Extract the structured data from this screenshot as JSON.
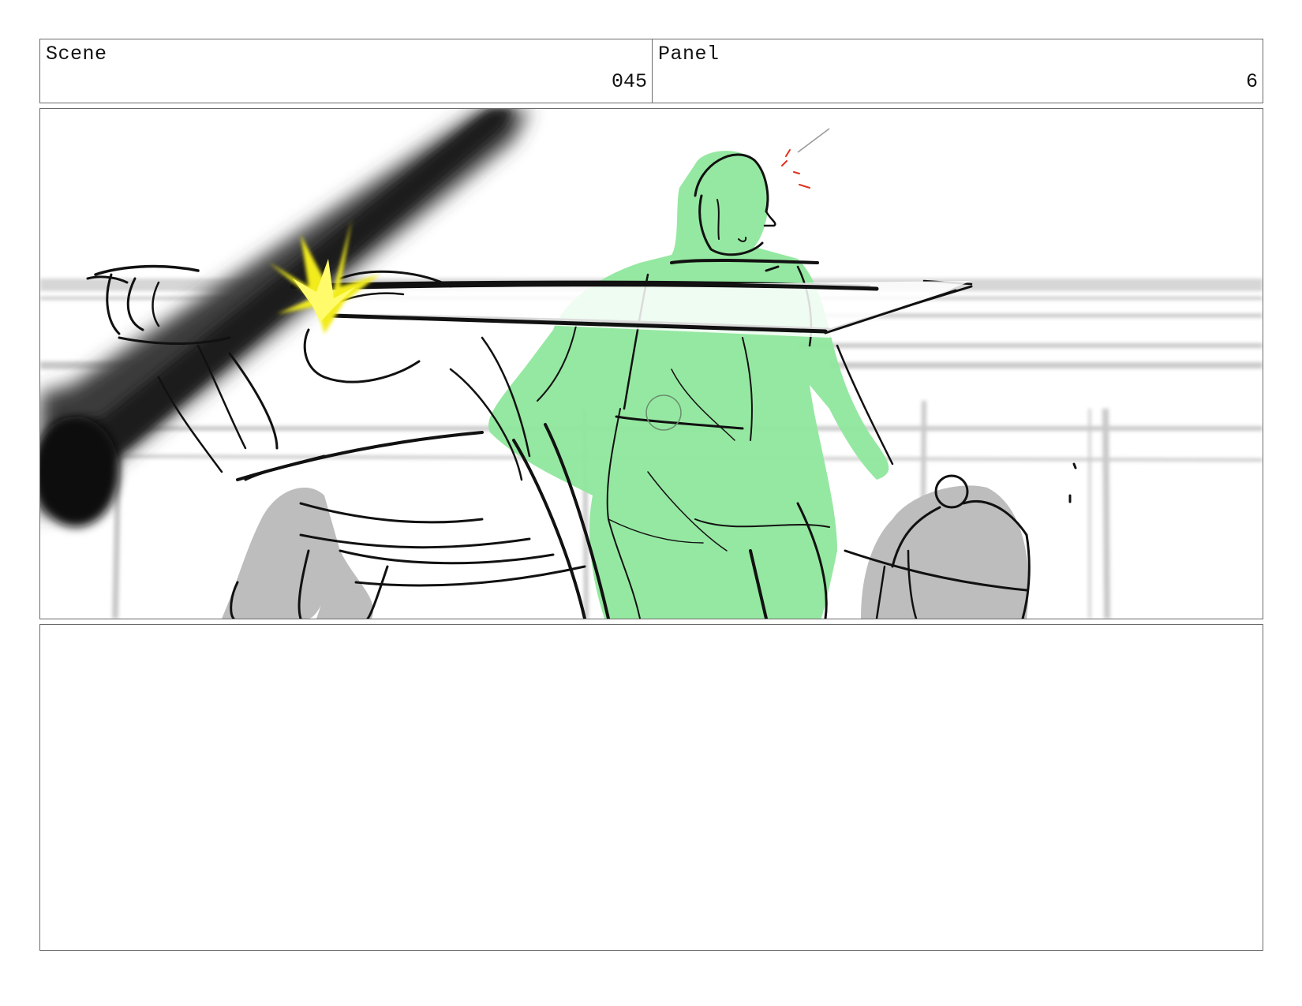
{
  "header": {
    "scene_label": "Scene",
    "scene_value": "045",
    "panel_label": "Panel",
    "panel_value": "6"
  },
  "frame": {
    "description_icon": "storyboard-sketch",
    "colors": {
      "highlight_figure": "#8fe79c",
      "impact_spark": "#f2ec1a",
      "motion_blur": "#2a2a2a",
      "ink": "#111111",
      "shadow_tone": "#bdbdbd",
      "accent_red": "#e0301e"
    }
  },
  "notes": {
    "text": ""
  }
}
